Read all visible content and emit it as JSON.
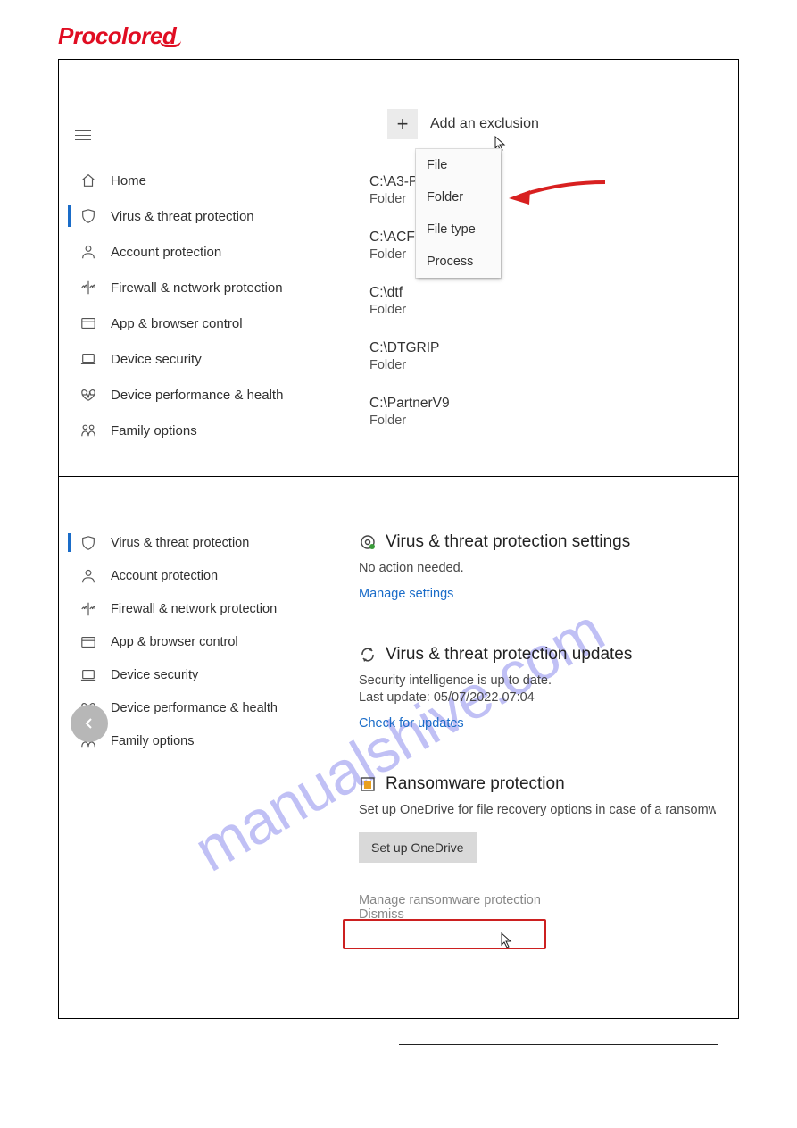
{
  "logo": "Procolored",
  "watermark": "manualshive.com",
  "panel1": {
    "nav": [
      {
        "icon": "home",
        "label": "Home"
      },
      {
        "icon": "shield",
        "label": "Virus & threat protection",
        "active": true
      },
      {
        "icon": "person",
        "label": "Account protection"
      },
      {
        "icon": "firewall",
        "label": "Firewall & network protection"
      },
      {
        "icon": "browser",
        "label": "App & browser control"
      },
      {
        "icon": "device",
        "label": "Device security"
      },
      {
        "icon": "heart",
        "label": "Device performance & health"
      },
      {
        "icon": "family",
        "label": "Family options"
      }
    ],
    "add_exclusion_label": "Add an exclusion",
    "dropdown": [
      "File",
      "Folder",
      "File type",
      "Process"
    ],
    "exclusions": [
      {
        "path": "C:\\A3-PR",
        "type": "Folder"
      },
      {
        "path": "C:\\ACF",
        "type": "Folder"
      },
      {
        "path": "C:\\dtf",
        "type": "Folder"
      },
      {
        "path": "C:\\DTGRIP",
        "type": "Folder"
      },
      {
        "path": "C:\\PartnerV9",
        "type": "Folder"
      }
    ]
  },
  "panel2": {
    "nav": [
      {
        "icon": "shield",
        "label": "Virus & threat protection",
        "active": true
      },
      {
        "icon": "person",
        "label": "Account protection"
      },
      {
        "icon": "firewall",
        "label": "Firewall & network protection"
      },
      {
        "icon": "browser",
        "label": "App & browser control"
      },
      {
        "icon": "device",
        "label": "Device security"
      },
      {
        "icon": "heart",
        "label": "Device performance & health"
      },
      {
        "icon": "family",
        "label": "Family options"
      }
    ],
    "settings": {
      "title": "Virus & threat protection settings",
      "text": "No action needed.",
      "link": "Manage settings"
    },
    "updates": {
      "title": "Virus & threat protection updates",
      "text1": "Security intelligence is up to date.",
      "text2": "Last update: 05/07/2022 07:04",
      "link": "Check for updates"
    },
    "ransomware": {
      "title": "Ransomware protection",
      "text": "Set up OneDrive for file recovery options in case of a ransomware attack.",
      "button": "Set up OneDrive",
      "manage": "Manage ransomware protection",
      "dismiss": "Dismiss"
    }
  }
}
